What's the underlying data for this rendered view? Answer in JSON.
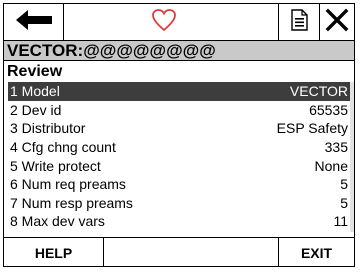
{
  "toolbar": {
    "back_icon": "arrow-left-icon",
    "heart_icon": "heart-icon",
    "heart_color": "#e03a3a",
    "doc_icon": "document-icon",
    "close_icon": "close-icon"
  },
  "title": "VECTOR:@@@@@@@@",
  "section": "Review",
  "items": [
    {
      "label": "1 Model",
      "value": "VECTOR",
      "selected": true
    },
    {
      "label": "2 Dev id",
      "value": "65535"
    },
    {
      "label": "3 Distributor",
      "value": "ESP Safety"
    },
    {
      "label": "4 Cfg chng count",
      "value": "335"
    },
    {
      "label": "5 Write protect",
      "value": "None"
    },
    {
      "label": "6 Num req preams",
      "value": "5"
    },
    {
      "label": "7 Num resp preams",
      "value": "5"
    },
    {
      "label": "8 Max dev vars",
      "value": "11"
    }
  ],
  "footer": {
    "help": "HELP",
    "exit": "EXIT"
  }
}
